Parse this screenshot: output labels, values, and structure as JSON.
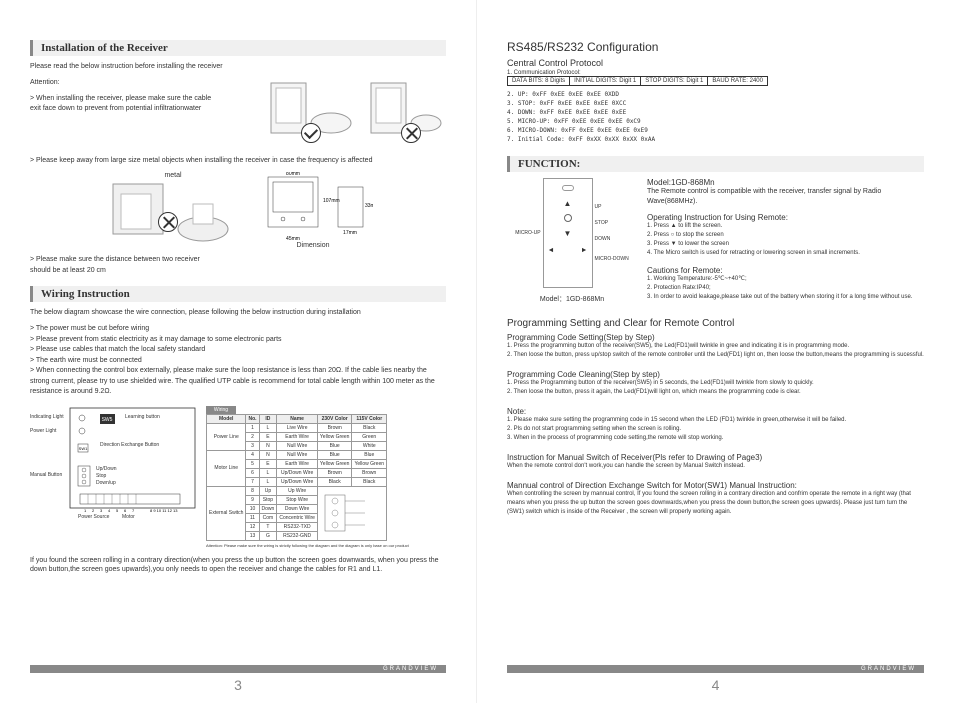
{
  "leftPage": {
    "section1": {
      "title": "Installation of the Receiver",
      "intro": "Please read the below instruction before installing the receiver",
      "attention": "Attention:",
      "bullet1a": "> When installing the receiver, please make sure the cable",
      "bullet1b": "   exit face down to prevent from potential infiltrationwater",
      "bullet2": "> Please keep away from large size metal objects when installing the receiver in case the frequency is affected",
      "metalLabel": "metal",
      "dimensionLabel": "Dimension",
      "bullet3a": "> Please make sure the distance between two receiver",
      "bullet3b": "   should be at least 20 cm"
    },
    "section2": {
      "title": "Wiring Instruction",
      "intro": "The below diagram showcase the wire connection, please following the below instruction during installation",
      "bullets": [
        "> The power must be cut before wiring",
        "> Please prevent from static electricity as it may damage to some electronic parts",
        "> Please use cables that match the local safety standard",
        "> The earth wire must be connected",
        "> When connecting the control box externally, please make sure the loop resistance is less than 20Ω. If the cable lies nearby the strong current, please try to use shielded wire. The qualified UTP cable is recommend for total cable length within 100 meter as the resistance is around 9.2Ω."
      ],
      "diagramLabels": {
        "indicatingLight": "Indicating Light",
        "powerLight": "Power Light",
        "sw5": "SW5",
        "learningButton": "Learning button",
        "sw1": "SW1",
        "directionExchange": "Direction Exchange Button",
        "manualButton": "Manual Button",
        "upDown": "Up/Down",
        "stop": "Stop",
        "downUp": "Down/up",
        "powerSource": "Power Source",
        "motor": "Motor"
      },
      "wiringTableHeader": "Wiring",
      "wiringTable": {
        "headers": [
          "Model",
          "No.",
          "ID",
          "Name",
          "230V Color",
          "115V Color"
        ],
        "rows": [
          [
            "Power Line",
            "1",
            "L",
            "Live Wire",
            "Brown",
            "Black"
          ],
          [
            "",
            "2",
            "E",
            "Earth Wire",
            "Yellow Green",
            "Green"
          ],
          [
            "",
            "3",
            "N",
            "Null Wire",
            "Blue",
            "White"
          ],
          [
            "Motor Line",
            "4",
            "N",
            "Null Wire",
            "Blue",
            "Blue"
          ],
          [
            "",
            "5",
            "E",
            "Earth Wire",
            "Yellow Green",
            "Yellow Green"
          ],
          [
            "",
            "6",
            "L",
            "Up/Down Wire",
            "Brown",
            "Brown"
          ],
          [
            "",
            "7",
            "L",
            "Up/Down Wire",
            "Black",
            "Black"
          ],
          [
            "External Switch",
            "8",
            "Up",
            "Up Wire",
            "",
            ""
          ],
          [
            "",
            "9",
            "Stop",
            "Stop Wire",
            "",
            ""
          ],
          [
            "",
            "10",
            "Down",
            "Down Wire",
            "",
            ""
          ],
          [
            "",
            "11",
            "Com",
            "Concentric Wire",
            "",
            ""
          ],
          [
            "",
            "12",
            "T",
            "RS232-TXD",
            "",
            ""
          ],
          [
            "",
            "13",
            "G",
            "RS232-GND",
            "",
            ""
          ]
        ],
        "note": "Attention: Please make sure the wiring is strictly following the diagram and the diagram is only base on our product"
      },
      "footnote": "If you found the screen rolling in a contrary direction(when you press the up button the screen goes downwards, when you press the down button,the screen goes upwards),you only needs to open the receiver and change the cables for R1 and L1."
    },
    "brand": "GRANDVIEW",
    "pageNum": "3"
  },
  "rightPage": {
    "section1": {
      "title": "RS485/RS232 Configuration",
      "subtitle": "Central Control Protocol",
      "subsub": "1. Communication Protocol:",
      "protocolCells": [
        "DATA BITS: 8 Digits",
        "INITIAL DIGITS: Digit 1",
        "STOP DIGITS: Digit 1",
        "BAUD RATE: 2400"
      ],
      "codes": [
        "2.   UP:      0xFF   0xEE   0xEE   0xEE   0XDD",
        "3.   STOP:  0xFF   0xEE   0xEE   0xEE   0XCC",
        "4.   DOWN:  0xFF   0xEE   0xEE   0xEE   0xEE",
        "5.   MICRO-UP:  0xFF 0xEE 0xEE 0xEE 0xC9",
        "6.   MICRO-DOWN: 0xFF 0xEE 0xEE 0xEE 0xE9",
        "7.   Initial Code: 0xFF 0xXX 0xXX 0xXX 0xAA"
      ]
    },
    "section2": {
      "title": "FUNCTION:",
      "remoteModel": "Model：1GD-868Mn",
      "remoteLabels": {
        "up": "UP",
        "stop": "STOP",
        "down": "DOWN",
        "microUp": "MICRO-UP",
        "microDown": "MICRO-DOWN"
      },
      "modelHeading": "Model:1GD-868Mn",
      "modelDesc": "The Remote control is compatible with the receiver, transfer signal by Radio Wave(868MHz).",
      "opHeading": "Operating Instruction for Using Remote:",
      "opSteps": [
        "1. Press ▲ to lift the screen.",
        "2. Press ○ to stop the screen",
        "3. Press ▼ to lower the screen",
        "4. The Micro switch is used for retracting or lowering screen in small increments."
      ],
      "cautionHeading": "Cautions for Remote:",
      "cautions": [
        "1. Working Temperature:-5℃~+40℃;",
        "2. Protection Rate:IP40;",
        "3. In order to avoid leakage,please take out of the battery when storing it for a long time without use."
      ]
    },
    "section3": {
      "heading": "Programming Setting and Clear for Remote Control",
      "sub1": "Programming Code Setting(Step by Step)",
      "steps1": [
        "1. Press the programming button of the receiver(SW5), the Led(FD1)will twinkle in gree and indicating it is in programming mode.",
        "2. Then loose the button, press up/stop switch of the remote controller until the Led(FD1) light on, then loose the button,means the programming is sucessful."
      ],
      "sub2": "Programming Code Cleaning(Step by step)",
      "steps2": [
        "1. Press the Programming button of the receiver(SW5) in 5 seconds, the Led(FD1)will twinkle from slowly to quickly.",
        "2. Then loose the button, press it again, the Led(FD1)will light on, which means the programming code is clear."
      ],
      "noteHeading": "Note:",
      "notes": [
        "1. Please make sure setting the programming code in 15 second when the LED (FD1) twinkle in green,otherwise it will be failed.",
        "2. Pls do not start programming setting when the screen is rolling.",
        "3. When in the process of programming code setting,the remote will stop working."
      ],
      "manualHeading": "Instruction for Manual Switch of Receiver(Pls refer to Drawing of Page3)",
      "manualText": "When the remote control don't work,you can handle the screen by Manual Switch instead.",
      "dirHeading": "Mannual control of Direction Exchange Switch for Motor(SW1) Manual Instruction:",
      "dirText": "When controlling the screen by mannual control,  If you found the screen rolling in a contrary direction and confrim operate the remote in a right way (that means when you press the up button the screen goes downwards,when you press the down button,the screen goes upwards). Please just turn  turn the (SW1) switch which is inside of the Receiver ,  the screen will properly working again."
    },
    "brand": "GRANDVIEW",
    "pageNum": "4"
  }
}
